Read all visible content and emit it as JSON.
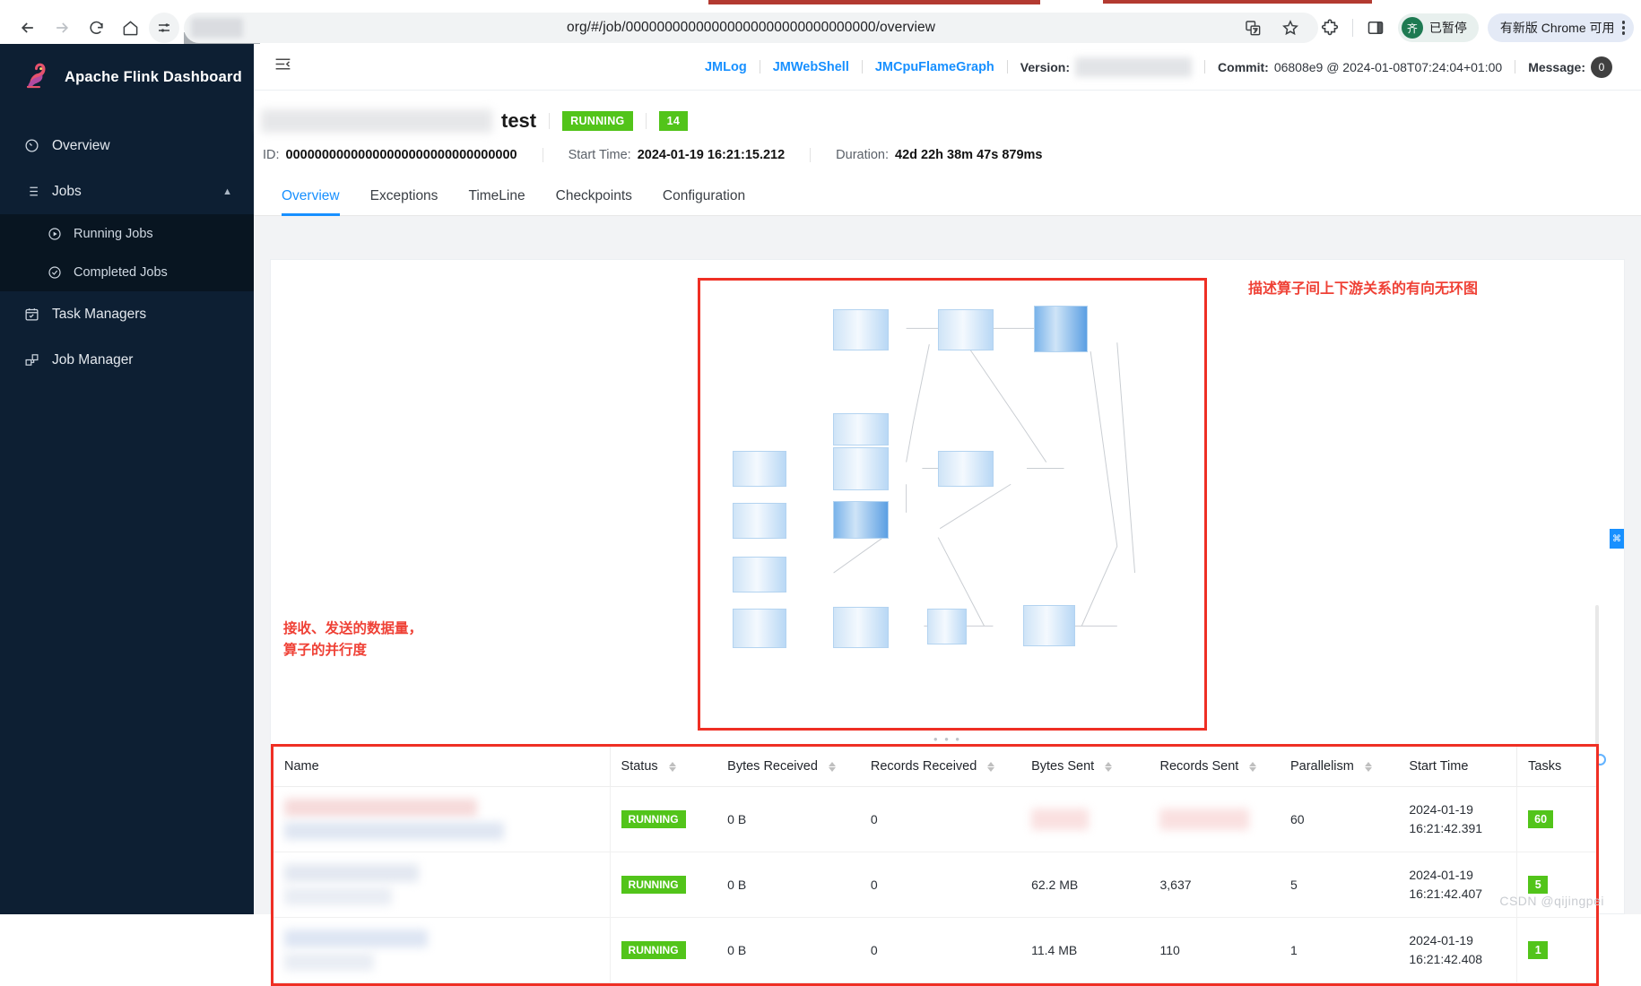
{
  "browser": {
    "nav": {
      "back": "back-arrow",
      "forward": "forward-arrow",
      "reload": "reload",
      "home": "home",
      "tune": "tune"
    },
    "url": "org/#/job/00000000000000000000000000000000/overview",
    "omnibox_icons": [
      "translate-icon",
      "bookmark-star-icon"
    ],
    "toolbar_icons": [
      "extensions-puzzle-icon",
      "side-panel-icon"
    ],
    "profile": {
      "initial": "齐",
      "label": "已暂停"
    },
    "update": {
      "label": "有新版 Chrome 可用",
      "menu": "kebab-menu"
    }
  },
  "sidebar": {
    "brand": "Apache Flink Dashboard",
    "items": [
      {
        "label": "Overview",
        "icon": "dashboard-icon"
      },
      {
        "label": "Jobs",
        "icon": "list-icon",
        "expanded": true
      },
      {
        "label": "Task Managers",
        "icon": "calendar-check-icon"
      },
      {
        "label": "Job Manager",
        "icon": "nodes-icon"
      }
    ],
    "sub_items": [
      {
        "label": "Running Jobs",
        "icon": "play-circle-icon"
      },
      {
        "label": "Completed Jobs",
        "icon": "check-circle-icon"
      }
    ]
  },
  "app_header": {
    "collapse_icon": "collapse-sidebar-icon",
    "links": [
      "JMLog",
      "JMWebShell",
      "JMCpuFlameGraph"
    ],
    "version_label": "Version:",
    "version_value": "",
    "commit_label": "Commit:",
    "commit_value": "06808e9 @ 2024-01-08T07:24:04+01:00",
    "message_label": "Message:",
    "message_count": "0"
  },
  "job": {
    "name": "test",
    "status": "RUNNING",
    "task_count": "14",
    "id_label": "ID:",
    "id_value": "00000000000000000000000000000000",
    "start_time_label": "Start Time:",
    "start_time_value": "2024-01-19 16:21:15.212",
    "duration_label": "Duration:",
    "duration_value": "42d 22h 38m 47s 879ms"
  },
  "tabs": [
    {
      "label": "Overview",
      "active": true
    },
    {
      "label": "Exceptions",
      "active": false
    },
    {
      "label": "TimeLine",
      "active": false
    },
    {
      "label": "Checkpoints",
      "active": false
    },
    {
      "label": "Configuration",
      "active": false
    }
  ],
  "annotations": {
    "graph": "描述算子间上下游关系的有向无环图",
    "table_line1": "接收、发送的数据量，",
    "table_line2": "算子的并行度"
  },
  "table": {
    "columns": [
      {
        "label": "Name",
        "sortable": false
      },
      {
        "label": "Status",
        "sortable": true
      },
      {
        "label": "Bytes Received",
        "sortable": true
      },
      {
        "label": "Records Received",
        "sortable": true
      },
      {
        "label": "Bytes Sent",
        "sortable": true
      },
      {
        "label": "Records Sent",
        "sortable": true
      },
      {
        "label": "Parallelism",
        "sortable": true
      },
      {
        "label": "Start Time",
        "sortable": false
      },
      {
        "label": "Tasks",
        "sortable": false
      }
    ],
    "rows": [
      {
        "name": "",
        "status": "RUNNING",
        "bytes_received": "0 B",
        "records_received": "0",
        "bytes_sent": "",
        "records_sent": "",
        "parallelism": "60",
        "start_time_date": "2024-01-19",
        "start_time_clock": "16:21:42.391",
        "tasks": "60"
      },
      {
        "name": "",
        "status": "RUNNING",
        "bytes_received": "0 B",
        "records_received": "0",
        "bytes_sent": "62.2 MB",
        "records_sent": "3,637",
        "parallelism": "5",
        "start_time_date": "2024-01-19",
        "start_time_clock": "16:21:42.407",
        "tasks": "5"
      },
      {
        "name": "",
        "status": "RUNNING",
        "bytes_received": "0 B",
        "records_received": "0",
        "bytes_sent": "11.4 MB",
        "records_sent": "110",
        "parallelism": "1",
        "start_time_date": "2024-01-19",
        "start_time_clock": "16:21:42.408",
        "tasks": "1"
      }
    ]
  },
  "watermark": "CSDN @qijingpei",
  "colors": {
    "accent": "#1890ff",
    "success": "#52c41a",
    "annotation": "#ef4136",
    "sidebar": "#0d1f33"
  }
}
